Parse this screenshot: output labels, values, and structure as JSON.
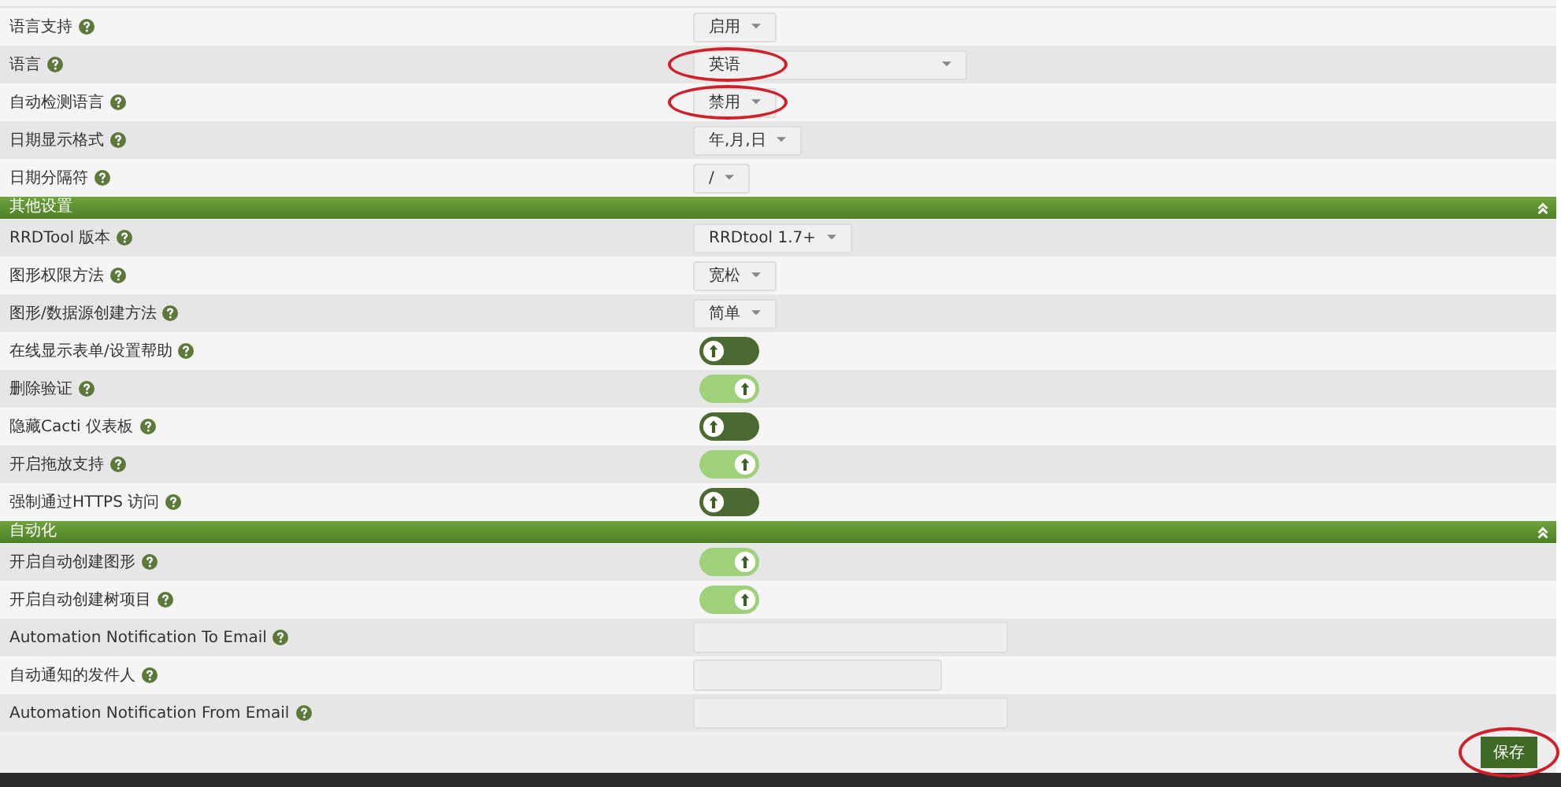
{
  "sections": [
    {
      "rows": [
        {
          "label": "语言支持",
          "kind": "select",
          "value": "启用",
          "circled": false
        },
        {
          "label": "语言",
          "kind": "wide-select",
          "value": "英语",
          "circled": true
        },
        {
          "label": "自动检测语言",
          "kind": "select",
          "value": "禁用",
          "circled": true
        },
        {
          "label": "日期显示格式",
          "kind": "select",
          "value": "年,月,日",
          "circled": false
        },
        {
          "label": "日期分隔符",
          "kind": "select",
          "value": "/",
          "circled": false
        }
      ]
    },
    {
      "title": "其他设置",
      "rows": [
        {
          "label": "RRDTool 版本",
          "kind": "select",
          "value": "RRDtool 1.7+",
          "circled": false
        },
        {
          "label": "图形权限方法",
          "kind": "select",
          "value": "宽松",
          "circled": false
        },
        {
          "label": "图形/数据源创建方法",
          "kind": "select",
          "value": "简单",
          "circled": false
        },
        {
          "label": "在线显示表单/设置帮助",
          "kind": "toggle",
          "on": false,
          "circled": false
        },
        {
          "label": "删除验证",
          "kind": "toggle",
          "on": true,
          "circled": false
        },
        {
          "label": "隐藏Cacti 仪表板",
          "kind": "toggle",
          "on": false,
          "circled": false
        },
        {
          "label": "开启拖放支持",
          "kind": "toggle",
          "on": true,
          "circled": false
        },
        {
          "label": "强制通过HTTPS 访问",
          "kind": "toggle",
          "on": false,
          "circled": false
        }
      ]
    },
    {
      "title": "自动化",
      "rows": [
        {
          "label": "开启自动创建图形",
          "kind": "toggle",
          "on": true,
          "circled": false
        },
        {
          "label": "开启自动创建树项目",
          "kind": "toggle",
          "on": true,
          "circled": false
        },
        {
          "label": "Automation Notification To Email",
          "kind": "text",
          "circled": false
        },
        {
          "label": "自动通知的发件人",
          "kind": "short-text",
          "circled": false
        },
        {
          "label": "Automation Notification From Email",
          "kind": "text",
          "circled": false
        }
      ]
    }
  ],
  "save_button": {
    "label": "保存",
    "circled": true
  }
}
